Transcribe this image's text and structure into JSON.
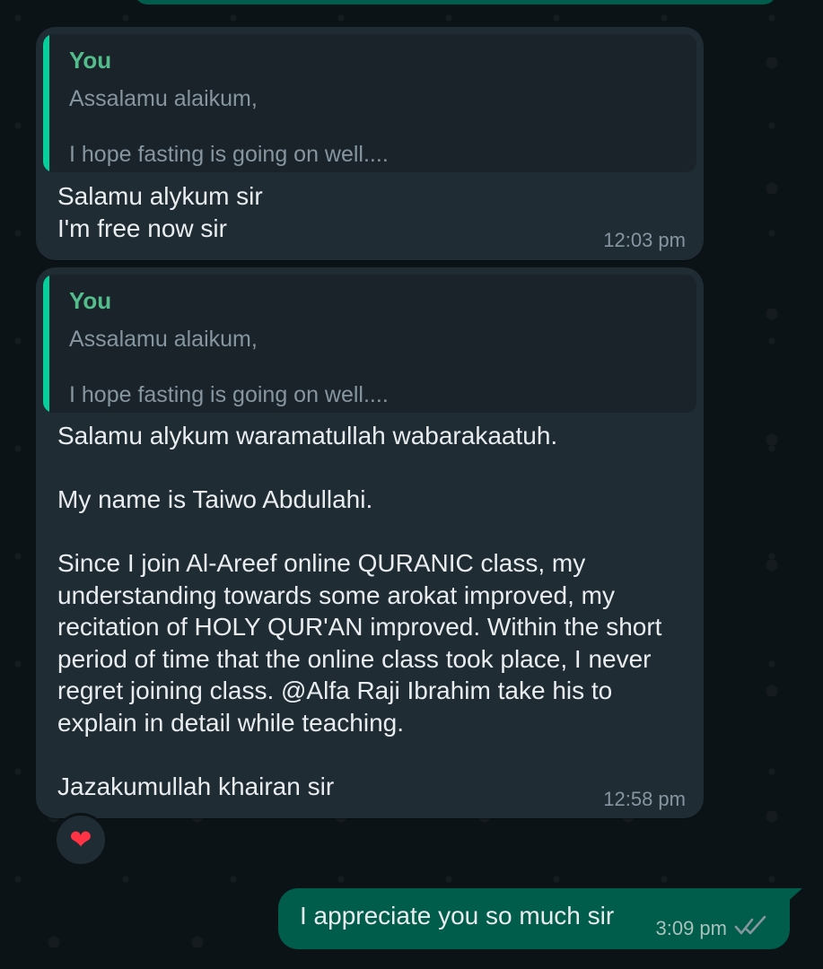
{
  "messages": [
    {
      "direction": "incoming",
      "quote": {
        "author": "You",
        "line1": "Assalamu alaikum,",
        "line2": "I hope fasting is going on well...."
      },
      "text": "Salamu alykum sir\nI'm free now sir",
      "time": "12:03 pm"
    },
    {
      "direction": "incoming",
      "quote": {
        "author": "You",
        "line1": "Assalamu alaikum,",
        "line2": "I hope fasting is going on well...."
      },
      "text": "Salamu alykum waramatullah wabarakaatuh.\n\nMy name is Taiwo Abdullahi.\n\nSince I join Al-Areef online QURANIC class, my understanding towards some arokat improved, my recitation of HOLY QUR'AN improved. Within the short period of time that the online class took place, I never regret joining class. @Alfa Raji Ibrahim take his to explain in detail while teaching.\n\nJazakumullah khairan sir",
      "time": "12:58 pm",
      "reaction": "❤"
    },
    {
      "direction": "outgoing",
      "text": "I appreciate you so much sir",
      "time": "3:09 pm",
      "status": "read-double-check"
    }
  ],
  "colors": {
    "incoming_bubble": "#1f2c34",
    "outgoing_bubble": "#005c4b",
    "quote_author": "#53bd8c",
    "quote_bar": "#06cf9c",
    "read_check": "#8696a0"
  }
}
